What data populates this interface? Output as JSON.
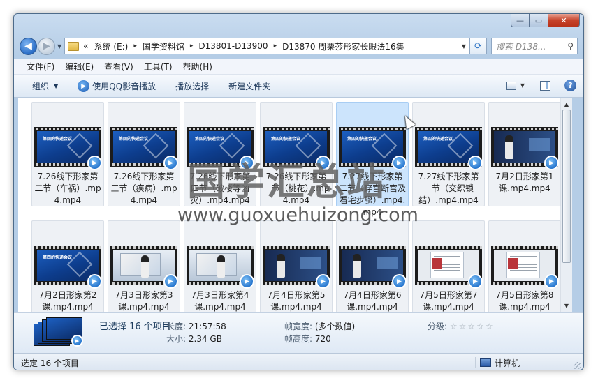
{
  "window": {
    "caption_buttons": {
      "minimize": "—",
      "maximize": "▭",
      "close": "✕"
    }
  },
  "nav": {
    "back_icon": "◀",
    "forward_icon": "▶",
    "dropdown_icon": "▼",
    "overflow": "«",
    "breadcrumbs": [
      "系统 (E:)",
      "国学资料馆",
      "D13801-D13900",
      "D13870 周栗莎形家长眼法16集"
    ],
    "crumb_sep": "▸",
    "refresh_icon": "⟳",
    "search_placeholder": "搜索 D138...",
    "search_icon": "⚲"
  },
  "menubar": [
    "文件(F)",
    "编辑(E)",
    "查看(V)",
    "工具(T)",
    "帮助(H)"
  ],
  "toolbar": {
    "organize": "组织",
    "play_qq": "使用QQ影音播放",
    "play_selection": "播放选择",
    "new_folder": "新建文件夹",
    "dropdown_icon": "▼",
    "help_icon": "?"
  },
  "files": [
    {
      "name": "7.26线下形家第二节（车祸）.mp4.mp4",
      "thumb": "slide"
    },
    {
      "name": "7.26线下形家第三节（疾病）.mp4.mp4",
      "thumb": "slide"
    },
    {
      "name": "7.26线下形家第四节（破楼等凶灾）.mp4.mp4",
      "thumb": "slide"
    },
    {
      "name": "7.26线下形家第一节（桃花）.mp4.mp4",
      "thumb": "slide"
    },
    {
      "name": "7.27线下形家第二节（穿宫断宫及看宅步骤）.mp4.mp4",
      "thumb": "slide",
      "highlight": true
    },
    {
      "name": "7.27线下形家第一节（交织锁结）.mp4.mp4",
      "thumb": "slide"
    },
    {
      "name": "7月2日形家第1课.mp4.mp4",
      "thumb": "presenter"
    },
    {
      "name": "7月2日形家第2课.mp4.mp4",
      "thumb": "slide"
    },
    {
      "name": "7月3日形家第3课.mp4.mp4",
      "thumb": "whiteboard"
    },
    {
      "name": "7月3日形家第4课.mp4.mp4",
      "thumb": "whiteboard"
    },
    {
      "name": "7月4日形家第5课.mp4.mp4",
      "thumb": "presenter"
    },
    {
      "name": "7月4日形家第6课.mp4.mp4",
      "thumb": "presenter"
    },
    {
      "name": "7月5日形家第7课.mp4.mp4",
      "thumb": "document"
    },
    {
      "name": "7月5日形家第8课.mp4.mp4",
      "thumb": "document"
    }
  ],
  "thumb_slide_title": "第四的快递会议",
  "badge_icon": "▶",
  "scroll": {
    "up": "▲",
    "down": "▼"
  },
  "details": {
    "selected": "已选择 16 个项目",
    "length_label": "长度:",
    "length_value": "21:57:58",
    "size_label": "大小:",
    "size_value": "2.34 GB",
    "frame_width_label": "帧宽度:",
    "frame_width_value": "(多个数值)",
    "frame_height_label": "帧高度:",
    "frame_height_value": "720",
    "rating_label": "分级:",
    "rating_stars": "☆☆☆☆☆",
    "rating_value": 0
  },
  "status": {
    "left": "选定 16 个项目",
    "right": "计算机"
  },
  "watermark": {
    "cn": "国学汇总站",
    "en": "www.guoxuehuizong.com"
  }
}
